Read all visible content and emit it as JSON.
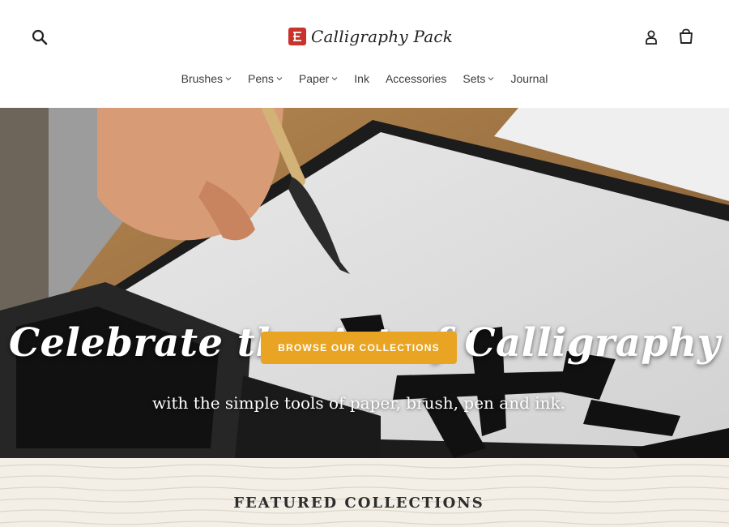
{
  "brand": {
    "name": "Calligraphy Pack",
    "accent": "#c8332c"
  },
  "header": {
    "search_icon": "search-icon",
    "account_icon": "account-icon",
    "cart_icon": "cart-icon"
  },
  "nav": {
    "items": [
      {
        "label": "Brushes",
        "has_dropdown": true
      },
      {
        "label": "Pens",
        "has_dropdown": true
      },
      {
        "label": "Paper",
        "has_dropdown": true
      },
      {
        "label": "Ink",
        "has_dropdown": false
      },
      {
        "label": "Accessories",
        "has_dropdown": false
      },
      {
        "label": "Sets",
        "has_dropdown": true
      },
      {
        "label": "Journal",
        "has_dropdown": false
      }
    ]
  },
  "hero": {
    "title": "Celebrate the Art of Calligraphy",
    "subtitle": "with the simple tools of paper, brush, pen and ink.",
    "cta_label": "BROWSE OUR COLLECTIONS",
    "cta_color": "#e8a422"
  },
  "featured": {
    "title": "FEATURED COLLECTIONS"
  }
}
